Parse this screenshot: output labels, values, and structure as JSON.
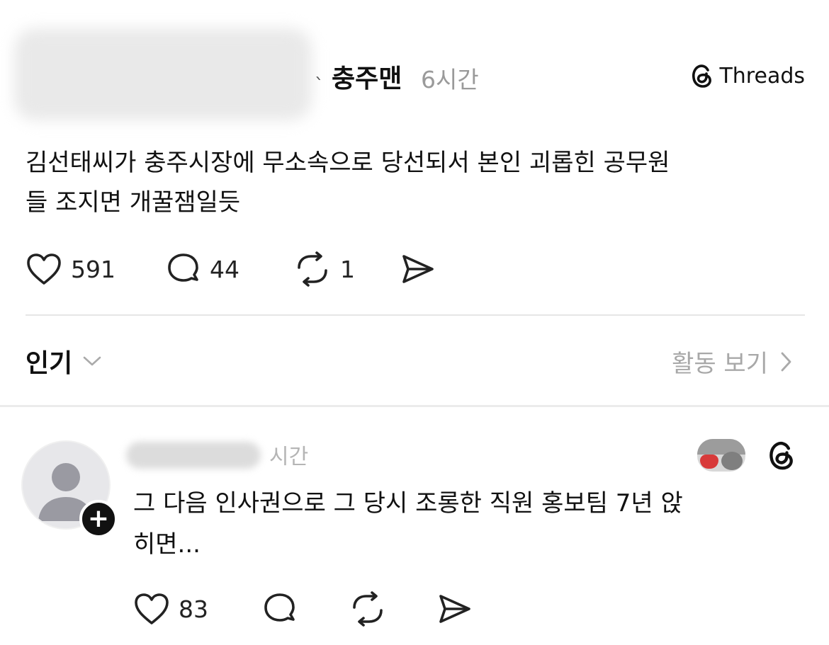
{
  "post": {
    "author": "충주맨",
    "time": "6시간",
    "brand": "Threads",
    "text_line1": "김선태씨가 충주시장에 무소속으로 당선되서 본인 괴롭힌 공무원",
    "text_line2": "들 조지면 개꿀잼일듯",
    "likes": "591",
    "comments": "44",
    "reposts": "1"
  },
  "replies_header": {
    "sort_label": "인기",
    "activity_label": "활동 보기"
  },
  "reply": {
    "time": "시간",
    "text_line1": "그 다음 인사권으로 그 당시 조롱한 직원 홍보팀 7년 앉",
    "text_line2": "히면...",
    "likes": "83"
  },
  "icons": {
    "threads": "threads-logo-icon",
    "like": "heart-icon",
    "comment": "comment-bubble-icon",
    "repost": "repost-icon",
    "share": "send-icon",
    "chevron_down": "chevron-down-icon",
    "chevron_right": "chevron-right-icon",
    "avatar": "default-avatar-icon",
    "follow": "plus-icon"
  }
}
